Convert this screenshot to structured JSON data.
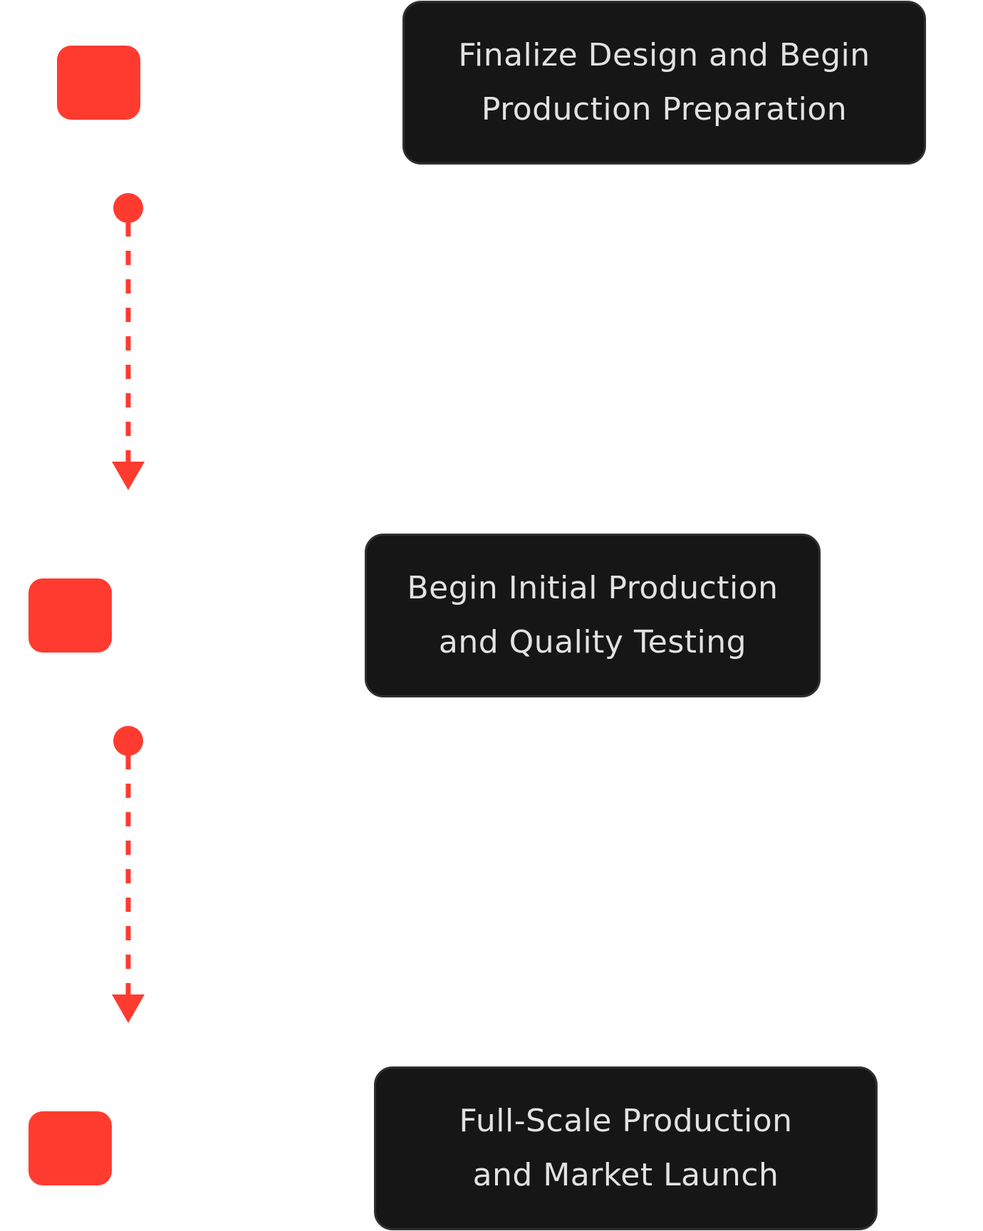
{
  "steps": [
    {
      "lines": [
        "Finalize Design and Begin",
        "Production Preparation"
      ]
    },
    {
      "lines": [
        "Begin Initial Production",
        "and Quality Testing"
      ]
    },
    {
      "lines": [
        "Full-Scale Production",
        "and Market Launch"
      ]
    }
  ],
  "colors": {
    "accent": "#ff3b30",
    "box_background": "#161616",
    "box_border": "#2f2f2f",
    "box_text": "#e2e2e2",
    "page_background": "#ffffff"
  }
}
